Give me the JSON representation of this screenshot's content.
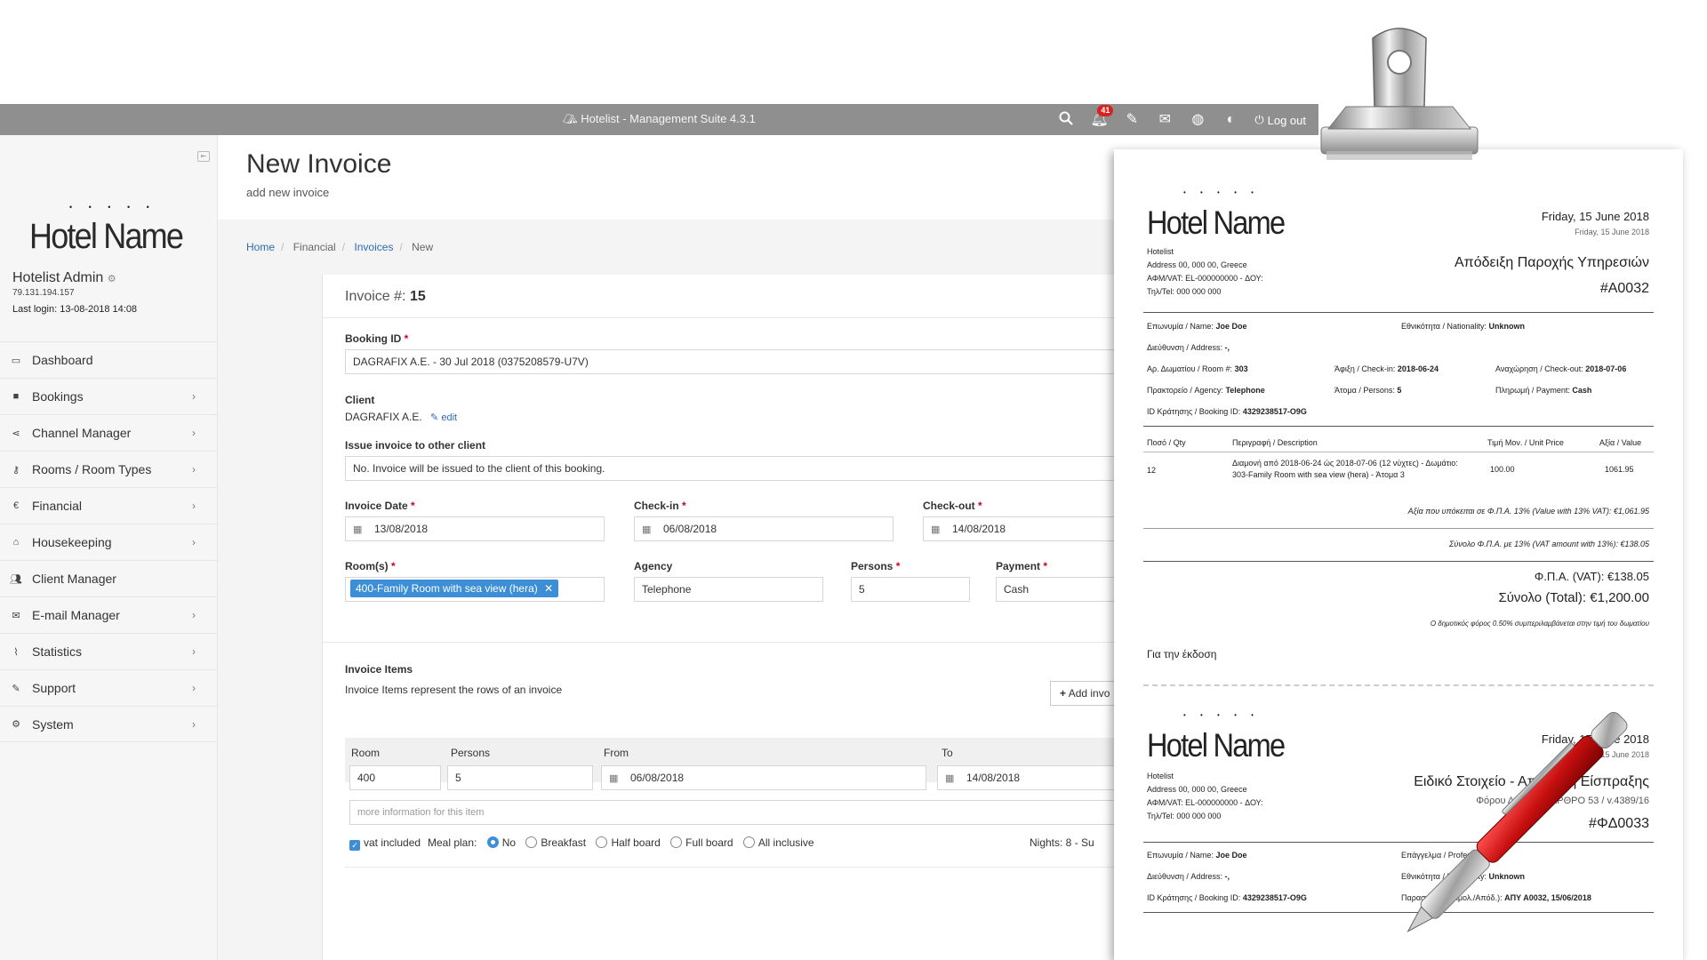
{
  "app": {
    "title": "Hotelist - Management Suite 4.3.1",
    "notification_count": "41",
    "logout_label": "Log out"
  },
  "sidebar": {
    "hotel_logo": "Hotel Name",
    "user_name": "Hotelist Admin",
    "user_ip": "79.131.194.157",
    "last_login": "Last login: 13-08-2018 14:08",
    "items": [
      {
        "label": "Dashboard",
        "icon": "monitor-icon",
        "chevron": false
      },
      {
        "label": "Bookings",
        "icon": "briefcase-icon",
        "chevron": true
      },
      {
        "label": "Channel Manager",
        "icon": "share-icon",
        "chevron": true
      },
      {
        "label": "Rooms / Room Types",
        "icon": "key-icon",
        "chevron": true
      },
      {
        "label": "Financial",
        "icon": "euro-icon",
        "chevron": true
      },
      {
        "label": "Housekeeping",
        "icon": "home-icon",
        "chevron": true
      },
      {
        "label": "Client Manager",
        "icon": "users-icon",
        "chevron": false
      },
      {
        "label": "E-mail Manager",
        "icon": "envelope-icon",
        "chevron": true
      },
      {
        "label": "Statistics",
        "icon": "chart-icon",
        "chevron": true
      },
      {
        "label": "Support",
        "icon": "ticket-icon",
        "chevron": true
      },
      {
        "label": "System",
        "icon": "cogs-icon",
        "chevron": true
      }
    ]
  },
  "page": {
    "title": "New Invoice",
    "subtitle": "add new invoice",
    "breadcrumb": [
      "Home",
      "Financial",
      "Invoices",
      "New"
    ]
  },
  "form": {
    "invoice_no_label": "Invoice #:",
    "invoice_no": "15",
    "booking_id_label": "Booking ID",
    "booking_id_value": "DAGRAFIX A.E. - 30 Jul 2018 (0375208579-U7V)",
    "client_label": "Client",
    "client_value": "DAGRAFIX A.E.",
    "client_edit": "edit",
    "other_client_label": "Issue invoice to other client",
    "other_client_value": "No. Invoice will be issued to the client of this booking.",
    "invoice_date_label": "Invoice Date",
    "invoice_date": "13/08/2018",
    "checkin_label": "Check-in",
    "checkin": "06/08/2018",
    "checkout_label": "Check-out",
    "checkout": "14/08/2018",
    "rooms_label": "Room(s)",
    "room_tag": "400-Family Room with sea view (hera)",
    "agency_label": "Agency",
    "agency": "Telephone",
    "persons_label": "Persons",
    "persons": "5",
    "payment_label": "Payment",
    "payment": "Cash",
    "items_title": "Invoice Items",
    "items_desc": "Invoice Items represent the rows of an invoice",
    "add_item_btn": "Add invo",
    "cols": {
      "room": "Room",
      "persons": "Persons",
      "from": "From",
      "to": "To"
    },
    "row": {
      "room": "400",
      "persons": "5",
      "from": "06/08/2018",
      "to": "14/08/2018"
    },
    "more_info_placeholder": "more information for this item",
    "vat_included": "vat included",
    "meal_plan_label": "Meal plan:",
    "meal_options": [
      "No",
      "Breakfast",
      "Half board",
      "Full board",
      "All inclusive"
    ],
    "meal_selected": "No",
    "nights_summary": "Nights: 8 - Su"
  },
  "receipt": {
    "logo": "Hotel Name",
    "company": "Hotelist",
    "address": "Address 00, 000 00, Greece",
    "vat": "ΑΦΜ/VAT: EL-000000000 - ΔΟΥ:",
    "tel": "Τηλ/Tel: 000 000 000",
    "date_main": "Friday, 15 June 2018",
    "date_small": "Friday, 15 June 2018",
    "doc_title": "Απόδειξη Παροχής Υπηρεσιών",
    "doc_no": "#A0032",
    "name_lbl": "Επωνυμία / Name:",
    "name_val": "Joe Doe",
    "nat_lbl": "Εθνικότητα / Nationality:",
    "nat_val": "Unknown",
    "addr_lbl": "Διεύθυνση / Address:",
    "addr_val": "-,",
    "room_lbl": "Αρ. Δωματίου / Room #:",
    "room_val": "303",
    "in_lbl": "Άφιξη / Check-in:",
    "in_val": "2018-06-24",
    "out_lbl": "Αναχώρηση / Check-out:",
    "out_val": "2018-07-06",
    "agency_lbl": "Πρακτορείο / Agency:",
    "agency_val": "Telephone",
    "persons_lbl": "Άτομα / Persons:",
    "persons_val": "5",
    "pay_lbl": "Πληρωμή / Payment:",
    "pay_val": "Cash",
    "bid_lbl": "ID Κράτησης / Booking ID:",
    "bid_val": "4329238517-O9G",
    "th_qty": "Ποσό / Qty",
    "th_desc": "Περιγραφή / Description",
    "th_unit": "Τιμή Μον. / Unit Price",
    "th_value": "Αξία / Value",
    "row_qty": "12",
    "row_desc1": "Διαμονή από 2018-06-24 ώς 2018-07-06 (12 νύχτες) - Δωμάτιο:",
    "row_desc2": "303-Family Room with sea view (hera) - Άτομα 3",
    "row_unit": "100.00",
    "row_value": "1061.95",
    "vat_base": "Αξία που υπόκειται σε Φ.Π.Α. 13% (Value with 13% VAT): €1,061.95",
    "vat_amount": "Σύνολο Φ.Π.Α. με 13% (VAT amount with 13%): €138.05",
    "vat_total": "Φ.Π.Α. (VAT): €138.05",
    "grand_total": "Σύνολο (Total): €1,200.00",
    "tax_note": "Ο δημοτικός φόρος 0.50% συμπεριλαμβάνεται στην τιμή του δωματίου",
    "issued_for": "Για την έκδοση",
    "second": {
      "date_main": "Friday, 15 June 2018",
      "date_small": "15 June 2018",
      "doc_title": "Ειδικό Στοιχείο - Απόδειξη Είσπραξης",
      "doc_sub": "Φόρου Διαμονής ΑΡΘΡΟ 53 / v.4389/16",
      "doc_no": "#ΦΔ0033",
      "prof_lbl": "Επάγγελμα / Profession:",
      "prof_val": "-",
      "nat_lbl": "Εθνικότητα / Nationality:",
      "nat_val": "Unknown",
      "ref_lbl": "Παραστατικό (Τιμολ./Απόδ.):",
      "ref_val": "ΑΠΥ Α0032, 15/06/2018"
    }
  },
  "colors": {
    "topbar": "#8f8f8f",
    "accent": "#3c8ed6",
    "required": "#d0021b",
    "badge": "#d9221f"
  }
}
